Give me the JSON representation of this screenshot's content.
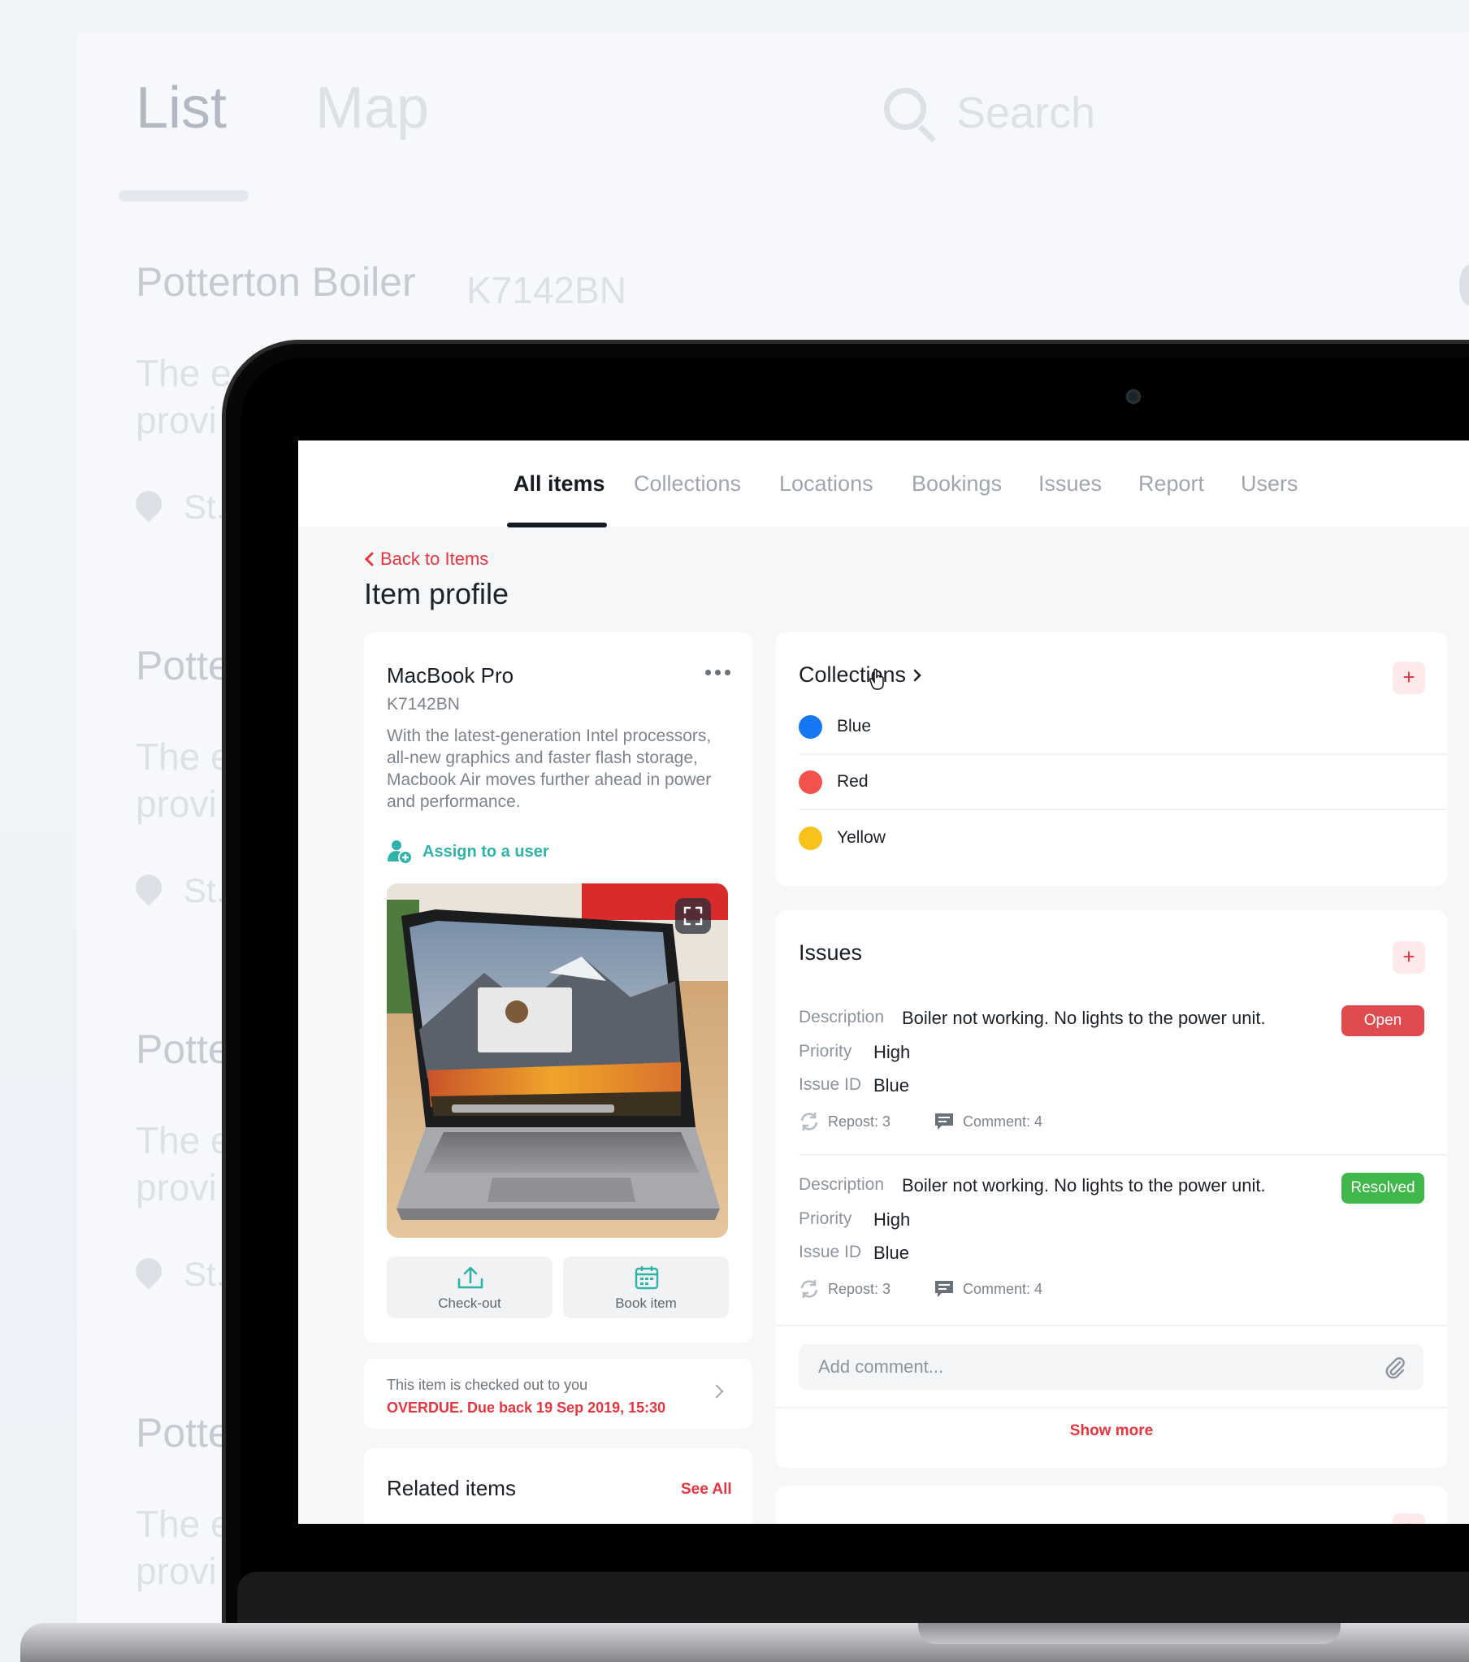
{
  "background": {
    "tabs": [
      "List",
      "Map"
    ],
    "search_placeholder": "Search",
    "rows": [
      {
        "title": "Potterton Boiler",
        "code": "K7142BN",
        "desc_line1": "The e",
        "desc_line2": "provi",
        "location": "St."
      },
      {
        "title": "Potte",
        "desc_line1": "The e",
        "desc_line2": "provi",
        "location": "St."
      },
      {
        "title": "Potte",
        "desc_line1": "The e",
        "desc_line2": "provi",
        "location": "St."
      },
      {
        "title": "Potte",
        "desc_line1": "The e",
        "desc_line2": "provi"
      }
    ]
  },
  "nav": {
    "tabs": [
      {
        "label": "All items",
        "active": true
      },
      {
        "label": "Collections"
      },
      {
        "label": "Locations"
      },
      {
        "label": "Bookings"
      },
      {
        "label": "Issues"
      },
      {
        "label": "Report"
      },
      {
        "label": "Users"
      }
    ]
  },
  "back_link": "Back to Items",
  "page_title": "Item profile",
  "item": {
    "name": "MacBook Pro",
    "code": "K7142BN",
    "description": "With the latest-generation Intel processors, all-new graphics and faster flash storage, Macbook Air moves further ahead in power and performance.",
    "assign_label": "Assign to a user",
    "actions": {
      "checkout": "Check-out",
      "book": "Book item"
    }
  },
  "checkout_notice": {
    "line1": "This item is checked out to you",
    "line2": "OVERDUE. Due back 19 Sep 2019, 15:30"
  },
  "related": {
    "title": "Related items",
    "see_all": "See All"
  },
  "collections": {
    "title": "Collections",
    "items": [
      {
        "name": "Blue",
        "color": "#1677f2"
      },
      {
        "name": "Red",
        "color": "#f2524c"
      },
      {
        "name": "Yellow",
        "color": "#f7c31b"
      }
    ]
  },
  "issues": {
    "title": "Issues",
    "labels": {
      "description": "Description",
      "priority": "Priority",
      "issue_id": "Issue ID"
    },
    "list": [
      {
        "description": "Boiler not working. No lights to the power unit.",
        "priority": "High",
        "issue_id": "Blue",
        "status": "Open",
        "status_color": "#e04b4f",
        "repost": "Repost: 3",
        "comment": "Comment: 4"
      },
      {
        "description": "Boiler not working. No lights to the power unit.",
        "priority": "High",
        "issue_id": "Blue",
        "status": "Resolved",
        "status_color": "#3fb74a",
        "repost": "Repost: 3",
        "comment": "Comment: 4"
      }
    ],
    "comment_placeholder": "Add comment...",
    "show_more": "Show more"
  },
  "colors": {
    "accent": "#e5353f",
    "teal": "#2fb3a8"
  }
}
